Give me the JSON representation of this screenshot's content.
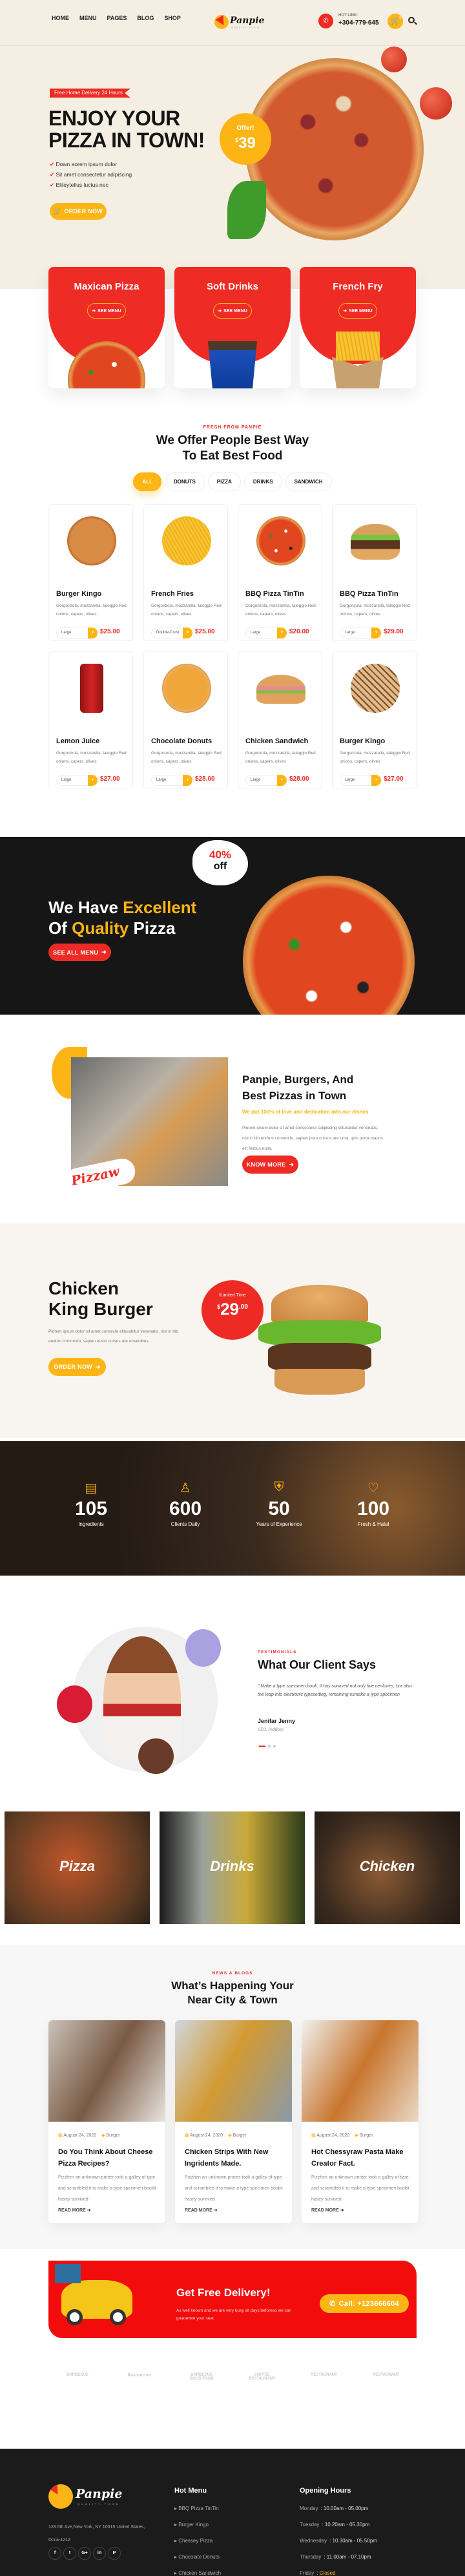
{
  "colors": {
    "red": "#ee2a24",
    "yellow": "#fdb515",
    "cream": "#f5efe3",
    "dark": "#161616"
  },
  "header": {
    "nav": [
      "HOME",
      "MENU",
      "PAGES",
      "BLOG",
      "SHOP"
    ],
    "logo": {
      "name": "Panpie",
      "tagline": "QUALITY FOOD"
    },
    "hotline_label": "HOT LINE:",
    "hotline": "+304-779-645",
    "cart_count": "0",
    "icons": [
      "phone-icon",
      "cart-icon",
      "search-icon"
    ]
  },
  "hero": {
    "tag": "Free Home Delivery 24 Hours",
    "title_line1": "ENJOY YOUR",
    "title_line2": "PIZZA IN TOWN!",
    "bullets": [
      "Down aorem ipsum dolor",
      "Sit amet consectetur adipiscing",
      "Eliteytellus luctus nec"
    ],
    "button": "ORDER NOW",
    "offer_label": "Offer!",
    "offer_currency": "$",
    "offer_price": "39"
  },
  "categories": [
    {
      "title": "Maxican Pizza",
      "button": "SEE MENU"
    },
    {
      "title": "Soft Drinks",
      "button": "SEE MENU"
    },
    {
      "title": "French Fry",
      "button": "SEE MENU"
    }
  ],
  "menu": {
    "subtitle": "FRESH FROM PANPIE",
    "title_line1": "We Offer People Best Way",
    "title_line2": "To Eat Best Food",
    "tabs": [
      "ALL",
      "DONUTS",
      "PIZZA",
      "DRINKS",
      "SANDWICH"
    ],
    "active_tab": "ALL",
    "products": [
      {
        "name": "Burger Kingo",
        "desc": "Gorgonzola, mozzarella, taleggio Red onions, capers, olives",
        "size": "Large",
        "price": "$25.00",
        "img": "plain"
      },
      {
        "name": "French Fries",
        "desc": "Gorgonzola, mozzarella, taleggio Red onions, capers, olives",
        "size": "Double-Crust",
        "price": "$25.00",
        "img": "fries"
      },
      {
        "name": "BBQ Pizza TinTin",
        "desc": "Gorgonzola, mozzarella, taleggio Red onions, capers, olives",
        "size": "Large",
        "price": "$20.00",
        "img": "veg"
      },
      {
        "name": "BBQ Pizza TinTin",
        "desc": "Gorgonzola, mozzarella, taleggio Red onions, capers, olives",
        "size": "Large",
        "price": "$29.00",
        "img": "burger"
      },
      {
        "name": "Lemon Juice",
        "desc": "Gorgonzola, mozzarella, taleggio Red onions, capers, olives",
        "size": "Large",
        "price": "$27.00",
        "img": "can"
      },
      {
        "name": "Chocolate Donuts",
        "desc": "Gorgonzola, mozzarella, taleggio Red onions, capers, olives",
        "size": "Large",
        "price": "$28.00",
        "img": "cheese"
      },
      {
        "name": "Chicken Sandwich",
        "desc": "Gorgonzola, mozzarella, taleggio Red onions, capers, olives",
        "size": "Large",
        "price": "$28.00",
        "img": "sandwich"
      },
      {
        "name": "Burger Kingo",
        "desc": "Gorgonzola, mozzarella, taleggio Red onions, capers, olives",
        "size": "Large",
        "price": "$27.00",
        "img": "panini"
      }
    ]
  },
  "promo": {
    "w1": "We Have ",
    "w2": "Excellent",
    "w3": "Of ",
    "w4": "Quality",
    "w5": " Pizza",
    "button": "SEE ALL MENU",
    "badge_pct": "40%",
    "badge_off": "off"
  },
  "about": {
    "title_line1": "Panpie, Burgers, And",
    "title_line2": "Best Pizzas in Town",
    "tagline": "We put 100% of love and dedication into our dishes",
    "text": "Piorem ipsum dolor sit amet consectetur adipiscing eliturabitur venenatis, nisl in bib endum commodo, sapien justo cursus are urna, quis porta mauris elit finibus nulla.",
    "button": "KNOW MORE",
    "sticker": "Pizzaw"
  },
  "burger": {
    "title_line1": "Chicken",
    "title_line2": "King Burger",
    "text": "Piorem ipsum dolor sit amet consecte eliturabitur venenatis, nisl in bib endum commodo, sapien eusto cursus are urnainibus.",
    "button": "ORDER NOW",
    "badge_label": "tLimited Time",
    "badge_currency": "$",
    "badge_price": "29",
    "badge_cents": ".00"
  },
  "stats": [
    {
      "value": "105",
      "label": "Ingredients",
      "icon": "ingredients-icon"
    },
    {
      "value": "600",
      "label": "Clients Daily",
      "icon": "user-icon"
    },
    {
      "value": "50",
      "label": "Years of Experience",
      "icon": "chef-shield-icon"
    },
    {
      "value": "100",
      "label": "Fresh & Halal",
      "icon": "heart-icon"
    }
  ],
  "testimonial": {
    "label": "TESTIMONIALS",
    "title": "What Our Client Says",
    "quote": "\" Make a type specimen book. It has survived not only five centuries, but also the leap into electronic typesetting, remaining esmake a type specimen",
    "name": "Jenifar Jenny",
    "role": "CEO, PsdBoss",
    "active_slide": 1,
    "slides": 3
  },
  "tiles": [
    "Pizza",
    "Drinks",
    "Chicken"
  ],
  "blog": {
    "label": "NEWS & BLOGS",
    "title_line1": "What’s Happening Your",
    "title_line2": "Near City & Town",
    "posts": [
      {
        "date": "August 24, 2020",
        "tag": "Burger",
        "title": "Do You Think About Cheese Pizza Recipes?",
        "text": "Pizzhen an unknown printer took a galley of type and scrambled it to make a type specimen booklt hasey survived",
        "more": "READ MORE"
      },
      {
        "date": "August 24, 2020",
        "tag": "Burger",
        "title": "Chicken Strips With New Ingridents Made.",
        "text": "Pizzhen an unknown printer took a galley of type and scrambled it to make a type specimen bookit hasey survived",
        "more": "READ MORE"
      },
      {
        "date": "August 24, 2020",
        "tag": "Burger",
        "title": "Hot Chessyraw Pasta Make Creator Fact.",
        "text": "Pizzhen an unknown printer took a galley of type and scrambled it to make a type specimen bookit hasey survived",
        "more": "READ MORE"
      }
    ]
  },
  "delivery": {
    "title": "Get Free Delivery!",
    "text": "As well known and we are very busy all days beforeso we can guarantee your seat.",
    "call": "Call: +123666604"
  },
  "brands": [
    "BARBECUE",
    "Restaurant",
    "BARBECUE GOOD FOOD",
    "COFFEE RESTAURANT",
    "RESTAURANT",
    "RESTAURANT"
  ],
  "footer": {
    "address": "128 6th Ave,New York, NY 10015 United States, Dcca-1212",
    "socials": [
      "facebook-icon",
      "twitter-icon",
      "google-plus-icon",
      "linkedin-icon",
      "pinterest-icon"
    ],
    "social_glyphs": [
      "f",
      "t",
      "G+",
      "in",
      "P"
    ],
    "hot_menu_title": "Hot Menu",
    "hot_menu": [
      "BBQ Pizza TinTin",
      "Burger Kingo",
      "Chessey Pizza",
      "Chocolate Donuts",
      "Chicken Sandwich"
    ],
    "hours_title": "Opening Hours",
    "hours": [
      {
        "day": "Monday",
        "time": ": 10.00am - 05.00pm"
      },
      {
        "day": "Tuesday",
        "time": ": 10.20am - 05.30pm"
      },
      {
        "day": "Wednesday",
        "time": ": 10.30am - 05.50pm"
      },
      {
        "day": "Thursday",
        "time": ": 11.00am - 07.10pm"
      },
      {
        "day": "Friday",
        "time": ": Closed"
      }
    ]
  }
}
